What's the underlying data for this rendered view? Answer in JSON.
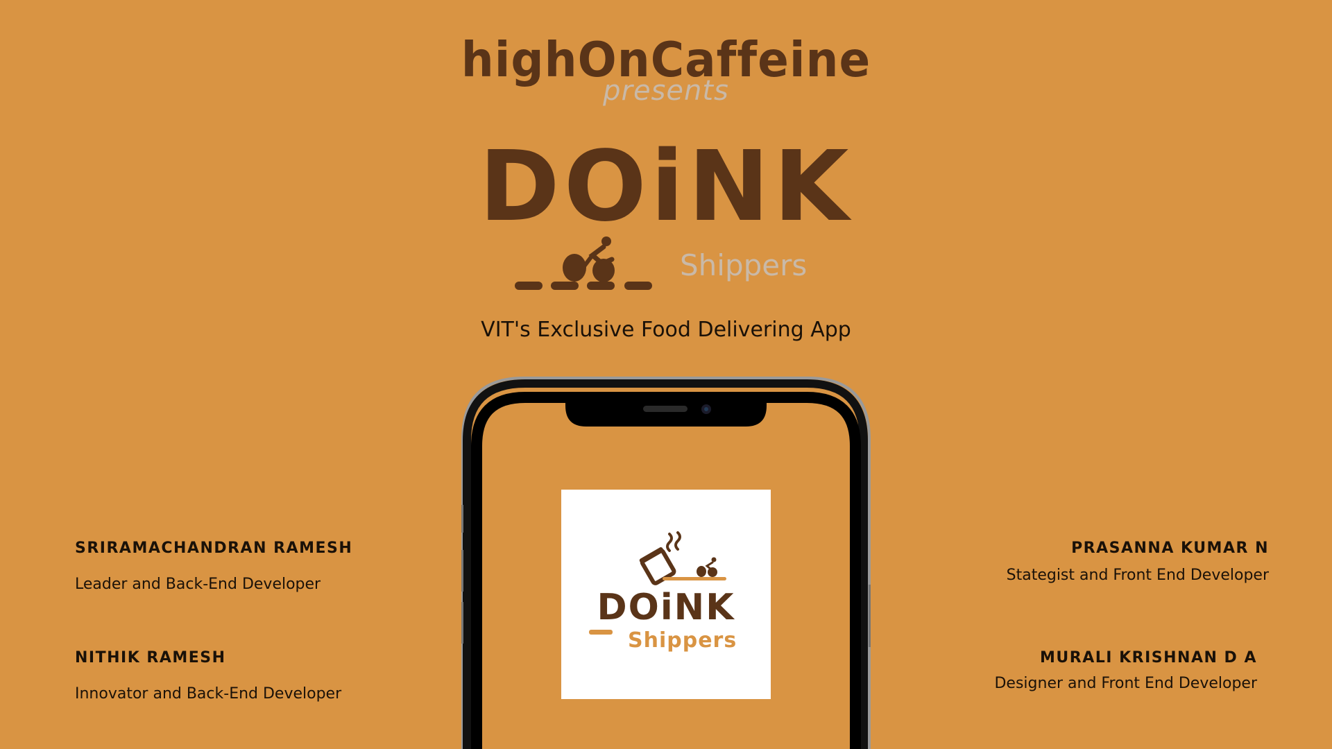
{
  "header": {
    "brand": "highOnCaffeine",
    "presents": "presents"
  },
  "product": {
    "title": "DOiNK",
    "subtitle": "Shippers",
    "tagline": "VIT's Exclusive Food Delivering App"
  },
  "logo": {
    "title": "DOiNK",
    "subtitle": "Shippers"
  },
  "team": {
    "left": [
      {
        "name": "SRIRAMACHANDRAN RAMESH",
        "role": "Leader and Back-End Developer"
      },
      {
        "name": "NITHIK RAMESH",
        "role": "Innovator and Back-End Developer"
      }
    ],
    "right": [
      {
        "name": "PRASANNA KUMAR N",
        "role": "Stategist and Front End Developer"
      },
      {
        "name": "MURALI KRISHNAN D A",
        "role": "Designer and Front End Developer"
      }
    ]
  },
  "colors": {
    "background": "#d99443",
    "brown": "#5a3418",
    "muted": "#c9b9a8"
  },
  "icons": [
    "cyclist-icon",
    "coffee-cup-icon",
    "smartphone-frame"
  ]
}
